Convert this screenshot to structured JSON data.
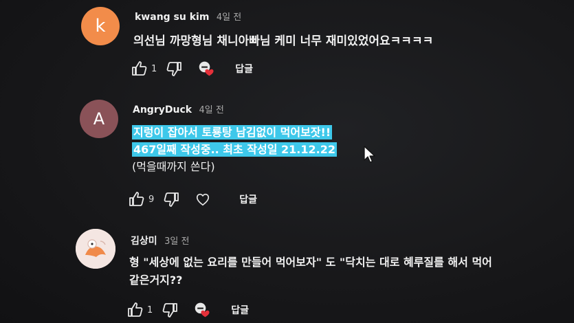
{
  "comments": [
    {
      "avatar_letter": "k",
      "avatar_color": "#f28c4a",
      "author": "kwang su kim",
      "time": "4일 전",
      "lines": [
        "의선님 까망형님 채니아빠님 케미 너무 재미있었어요ㅋㅋㅋㅋ"
      ],
      "likes": "1",
      "reply_label": "답글"
    },
    {
      "avatar_letter": "A",
      "avatar_color": "#8a5258",
      "author": "AngryDuck",
      "time": "4일 전",
      "lines": [
        "지렁이 잡아서 토룡탕 남김없이 먹어보잣!!",
        "467일째 작성중.. 최초 작성일 21.12.22",
        "(먹을때까지 쓴다)"
      ],
      "likes": "9",
      "reply_label": "답글"
    },
    {
      "avatar_letter": "",
      "avatar_color": "#f4e6e2",
      "author": "김상미",
      "time": "3일 전",
      "lines": [
        "형 \"세상에 없는 요리를 만들어 먹어보자\" 도 \"닥치는 대로 혜루질를 해서 먹어",
        "같은거지??"
      ],
      "likes": "1",
      "reply_label": "답글"
    }
  ],
  "icons": {
    "like": "thumbs-up-icon",
    "dislike": "thumbs-down-icon",
    "creator_heart": "creator-heart-icon",
    "heart": "heart-outline-icon",
    "cursor": "mouse-cursor-icon"
  },
  "colors": {
    "background": "#18181a",
    "highlight": "#3ec8ea",
    "heart_red": "#e5303a"
  }
}
